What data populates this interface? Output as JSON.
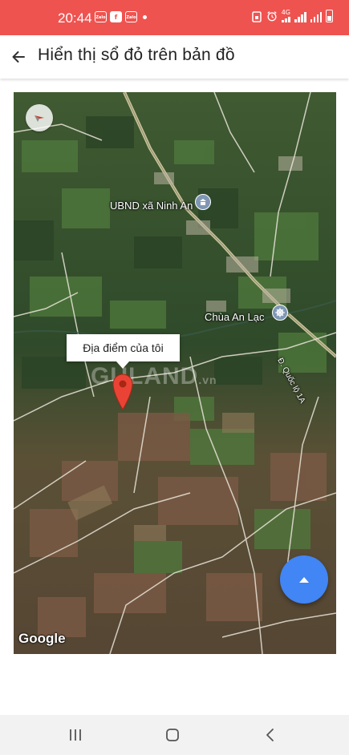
{
  "status_bar": {
    "time": "20:44",
    "app_badges": [
      "Zalo",
      "f",
      "Zalo"
    ],
    "network": "4G",
    "background_color": "#ef5350"
  },
  "header": {
    "back_icon": "arrow-left-icon",
    "title": "Hiển thị sổ đỏ trên bản đồ"
  },
  "map": {
    "labels": {
      "ubnd": "UBND xã Ninh An",
      "pagoda": "Chùa An Lạc",
      "road": "Đ. Quốc lộ 1A"
    },
    "info_window": "Địa điểm của tôi",
    "watermark": "GULAND",
    "watermark_suffix": ".vn",
    "attribution": "Google",
    "compass_icon": "compass-icon",
    "fab_icon": "chevron-up-icon",
    "fab_color": "#4285f4"
  },
  "nav_bar": {
    "buttons": [
      "recents-icon",
      "home-icon",
      "back-icon"
    ]
  }
}
